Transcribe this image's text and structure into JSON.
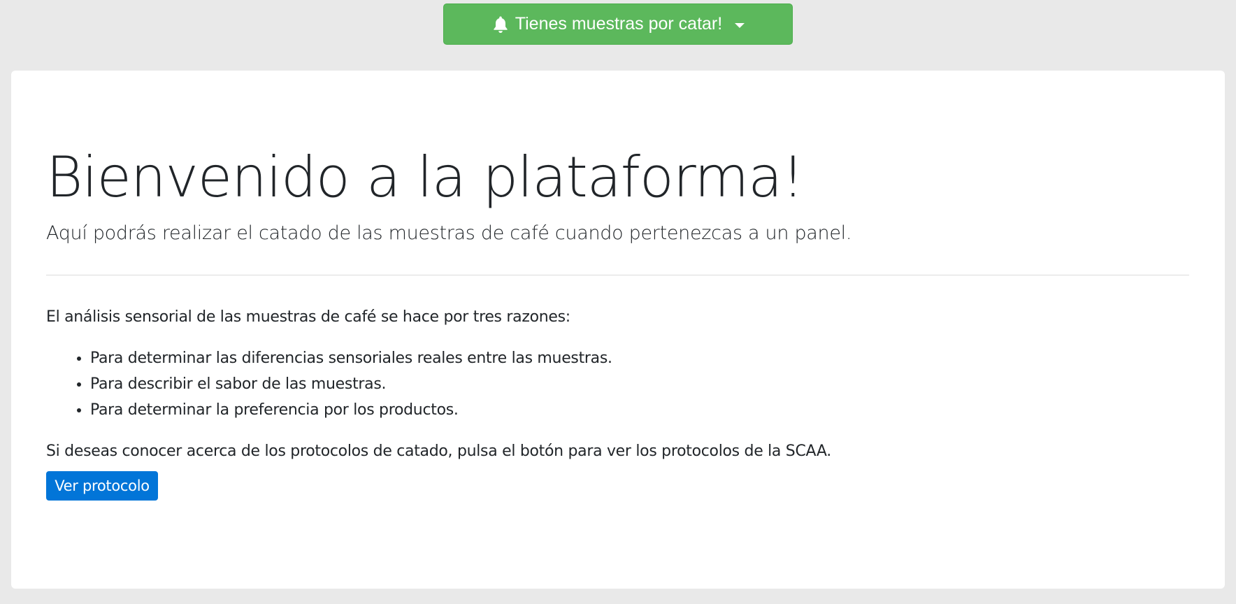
{
  "notification": {
    "label": "Tienes muestras por catar!",
    "icon": "bell-icon",
    "color": "#5cb85c"
  },
  "welcome": {
    "title": "Bienvenido a la plataforma!",
    "lead": "Aquí podrás realizar el catado de las muestras de café cuando pertenezcas a un panel."
  },
  "content": {
    "intro": "El análisis sensorial de las muestras de café se hace por tres razones:",
    "reasons": [
      "Para determinar las diferencias sensoriales reales entre las muestras.",
      "Para describir el sabor de las muestras.",
      "Para determinar la preferencia por los productos."
    ],
    "closing": "Si deseas conocer acerca de los protocolos de catado, pulsa el botón para ver los protocolos de la SCAA."
  },
  "actions": {
    "protocol_label": "Ver protocolo",
    "protocol_color": "#0275d8"
  }
}
